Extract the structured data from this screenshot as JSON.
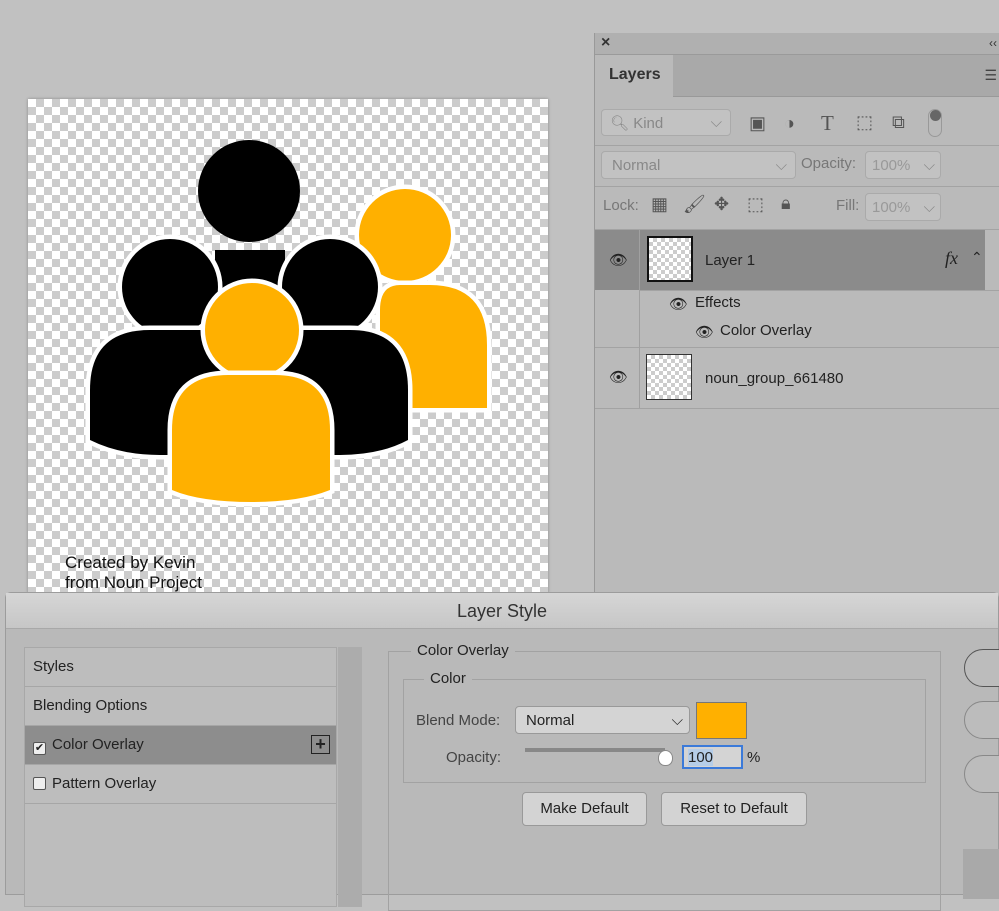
{
  "canvas": {
    "credit_line1": "Created by Kevin",
    "credit_line2": "from Noun Project",
    "colors": {
      "black": "#000000",
      "orange": "#ffb000"
    }
  },
  "layers_panel": {
    "close_icon": "×",
    "collapse_icon": "‹‹",
    "tab": "Layers",
    "filter": {
      "value": "Kind"
    },
    "blend_mode": "Normal",
    "opacity_label": "Opacity:",
    "opacity_value": "100%",
    "lock_label": "Lock:",
    "fill_label": "Fill:",
    "fill_value": "100%",
    "layers": [
      {
        "name": "Layer 1",
        "fx": "fx",
        "selected": true,
        "effects_label": "Effects",
        "effects": [
          "Color Overlay"
        ]
      },
      {
        "name": "noun_group_661480",
        "selected": false
      }
    ]
  },
  "layer_style": {
    "title": "Layer Style",
    "list": [
      {
        "label": "Styles"
      },
      {
        "label": "Blending Options"
      },
      {
        "label": "Color Overlay",
        "checked": true,
        "selected": true
      },
      {
        "label": "Pattern Overlay",
        "checked": false
      }
    ],
    "section_title": "Color Overlay",
    "group_title": "Color",
    "blend_mode_label": "Blend Mode:",
    "blend_mode": "Normal",
    "swatch_color": "#ffb000",
    "opacity_label": "Opacity:",
    "opacity_value": "100",
    "opacity_unit": "%",
    "opacity_percent": 100,
    "make_default": "Make Default",
    "reset_default": "Reset to Default"
  }
}
